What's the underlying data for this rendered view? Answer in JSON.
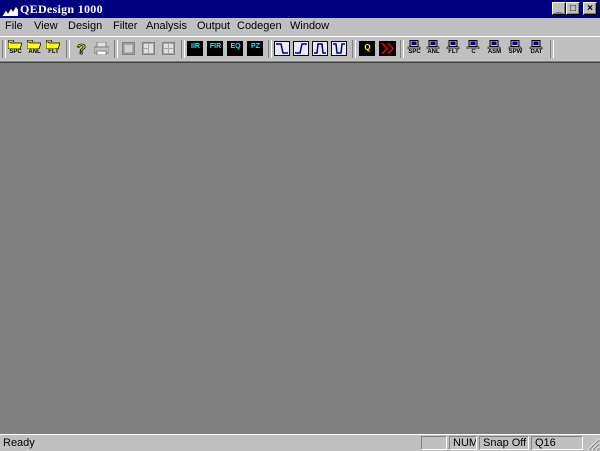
{
  "window": {
    "title": "QEDesign 1000",
    "controls": {
      "minimize": "_",
      "maximize": "□",
      "close": "×"
    }
  },
  "menu": [
    "File",
    "View",
    "Design",
    "Filter",
    "Analysis",
    "Output",
    "Codegen",
    "Window"
  ],
  "toolbar": {
    "open": [
      {
        "label": "SPC",
        "icon": "folder-icon"
      },
      {
        "label": "ANL",
        "icon": "folder-icon"
      },
      {
        "label": "FLT",
        "icon": "folder-icon"
      }
    ],
    "help": {
      "icon": "question-icon"
    },
    "print": {
      "icon": "printer-icon"
    },
    "layout": [
      {
        "icon": "layout-1-icon"
      },
      {
        "icon": "layout-2-icon"
      },
      {
        "icon": "layout-4-icon"
      }
    ],
    "design": [
      "IIR",
      "FIR",
      "EQ",
      "PZ"
    ],
    "responses": [
      {
        "icon": "lowpass-icon"
      },
      {
        "icon": "highpass-icon"
      },
      {
        "icon": "bandpass-icon"
      },
      {
        "icon": "bandstop-icon"
      }
    ],
    "quantize": {
      "label": "Q"
    },
    "run": {
      "icon": "double-chevron-icon"
    },
    "codegen": [
      "SPC",
      "ANL",
      "FLT",
      "C",
      "ASM",
      "SPW",
      "DAT"
    ]
  },
  "status": {
    "text": "Ready",
    "panels": [
      "",
      "NUM",
      "Snap Off",
      "Q16"
    ]
  },
  "colors": {
    "titlebar": "#000080",
    "workspace": "#808080",
    "face": "#c0c0c0",
    "design_label": "#00ffff",
    "run_arrow": "#ff0000",
    "quantize_label": "#ffff00"
  }
}
